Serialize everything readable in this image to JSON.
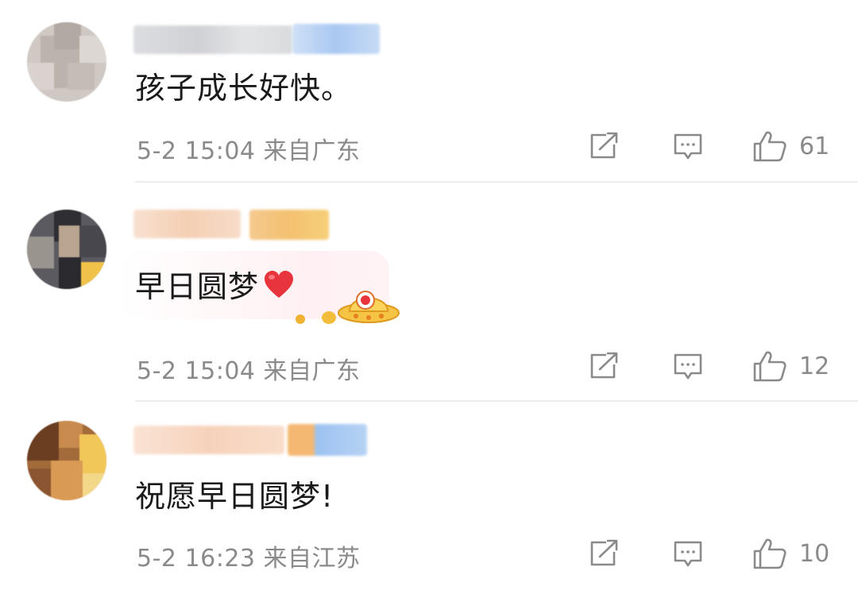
{
  "comments": [
    {
      "text": "孩子成长好快。",
      "time": "5-2 15:04",
      "location": "来自广东",
      "likes": "61",
      "avatar_colors": [
        "#c9c2bd",
        "#bdb4ae",
        "#d6cfcb",
        "#b7aea8"
      ],
      "name_colors": [
        "#d9dadd",
        "#c9cdd6",
        "#b9d0f2"
      ]
    },
    {
      "text": "早日圆梦",
      "emoji": "heart-emoji",
      "time": "5-2 15:04",
      "location": "来自广东",
      "likes": "12",
      "avatar_colors": [
        "#3d3d42",
        "#8a8076",
        "#c9b9a6",
        "#f0c24a"
      ],
      "name_colors": [
        "#f6d7bf",
        "#f2c48f",
        "#f6c96b"
      ]
    },
    {
      "text": "祝愿早日圆梦!",
      "time": "5-2 16:23",
      "location": "来自江苏",
      "likes": "10",
      "avatar_colors": [
        "#7a4a2a",
        "#c07a3c",
        "#e6b25a",
        "#f2d07a"
      ],
      "name_colors": [
        "#f7d8c2",
        "#f5c58f",
        "#8fb8ef"
      ]
    }
  ],
  "colors": {
    "text": "#1a1a1a",
    "meta": "#8a8a8a",
    "divider": "#ececec",
    "heart": "#e8343c"
  },
  "icons": {
    "share": "share-icon",
    "comment": "comment-icon",
    "like": "thumbs-up-icon"
  }
}
